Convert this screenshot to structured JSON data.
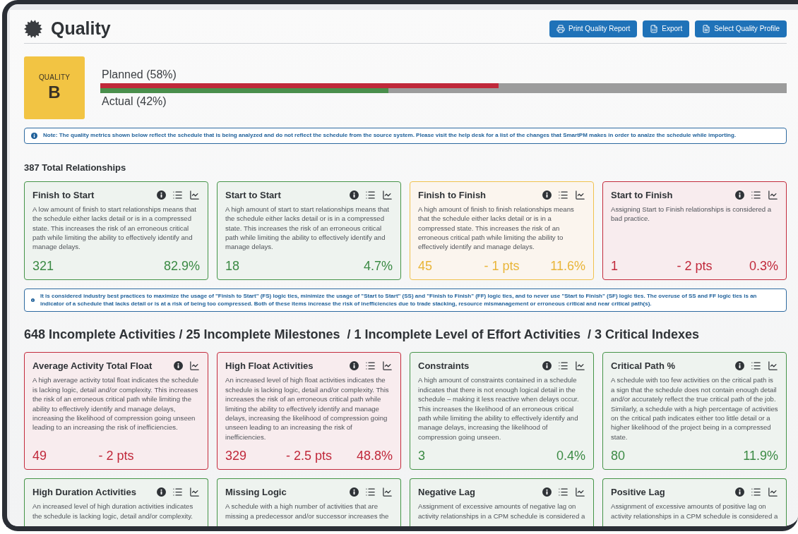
{
  "header": {
    "title": "Quality",
    "buttons": [
      {
        "label": "Print Quality Report",
        "kind": "print"
      },
      {
        "label": "Export",
        "kind": "export"
      },
      {
        "label": "Select Quality Profile",
        "kind": "profile"
      }
    ]
  },
  "grade": {
    "label": "QUALITY",
    "value": "B"
  },
  "progress": [
    {
      "label": "Planned (58%)",
      "kind": "planned",
      "level": 0.58
    },
    {
      "label": "Actual (42%)",
      "kind": "actual",
      "level": 0.42
    }
  ],
  "note": "Note: The quality metrics shown below reflect the schedule that is being analyzed and do not reflect the schedule from the source system. Please visit the help desk for a list of the changes that SmartPM makes in order to analze the schedule while importing.",
  "sections": [
    {
      "heading": "387 Total Relationships",
      "kind": "minor",
      "cards": [
        {
          "title": "Finish to Start",
          "kind": "good",
          "list_icon": true,
          "description": "A low amount of finish to start relationships means that the schedule either lacks detail or is in a compressed state. This increases the risk of an erroneous critical path while limiting the ability to effectively identify and manage delays.",
          "count": "321",
          "percent": "82.9%"
        },
        {
          "title": "Start to Start",
          "kind": "good",
          "list_icon": true,
          "description": "A high amount of start to start relationships means that the schedule either lacks detail or is in a compressed state. This increases the risk of an erroneous critical path while limiting the ability to effectively identify and manage delays.",
          "count": "18",
          "percent": "4.7%"
        },
        {
          "title": "Finish to Finish",
          "kind": "warning",
          "list_icon": true,
          "description": "A high amount of finish to finish relationships means that the schedule either lacks detail or is in a compressed state. This increases the risk of an erroneous critical path while limiting the ability to effectively identify and manage delays.",
          "count": "45",
          "points": "- 1 pts",
          "percent": "11.6%"
        },
        {
          "title": "Start to Finish",
          "kind": "bad",
          "list_icon": true,
          "description": "Assigning Start to Finish relationships is considered a bad practice.",
          "count": "1",
          "points": "- 2 pts",
          "percent": "0.3%"
        }
      ],
      "note": "It is considered industry best practices to maximize the usage of \"Finish to Start\" (FS) logic ties, minimize the usage of \"Start to Start\" (SS) and \"Finish to Finish\" (FF) logic ties, and to never use \"Start to Finish\" (SF) logic ties. The overuse of SS and FF logic ties is an indicator of a schedule that lacks detail or is at a risk of being too compressed. Both of these items increase the risk of inefficiencies due to trade stacking, resource mismanagement or erroneous critical and near critical path(s)."
    },
    {
      "heading": "648 Incomplete Activities / 25 Incomplete Milestones  / 1 Incomplete Level of Effort Activities  / 3 Critical Indexes",
      "kind": "major",
      "cards": [
        {
          "title": "Average Activity Total Float",
          "kind": "bad",
          "list_icon": false,
          "description": "A high average activity total float indicates the schedule is lacking logic, detail and/or complexity. This increases the risk of an erroneous critical path while limiting the ability to effectively identify and manage delays, increasing the likelihood of compression going unseen leading to an increasing the risk of inefficiencies.",
          "count": "49",
          "points": "- 2 pts"
        },
        {
          "title": "High Float Activities",
          "kind": "bad",
          "list_icon": true,
          "description": "An increased level of high float activities indicates the schedule is lacking logic, detail and/or complexity. This increases the risk of an erroneous critical path while limiting the ability to effectively identify and manage delays, increasing the likelihood of compression going unseen leading to an increasing the risk of inefficiencies.",
          "count": "329",
          "points": "- 2.5 pts",
          "percent": "48.8%"
        },
        {
          "title": "Constraints",
          "kind": "good",
          "list_icon": true,
          "description": "A high amount of constraints contained in a schedule indicates that there is not enough logical detail in the schedule – making it less reactive when delays occur. This increases the likelihood of an erroneous critical path while limiting the ability to effectively identify and manage delays, increasing the likelihood of compression going unseen.",
          "count": "3",
          "percent": "0.4%"
        },
        {
          "title": "Critical Path %",
          "kind": "good",
          "list_icon": true,
          "description": "A schedule with too few activities on the critical path is a sign that the schedule does not contain enough detail and/or accurately reflect the true critical path of the job. Similarly, a schedule with a high percentage of activities on the critical path indicates either too little detail or a higher likelihood of the project being in a compressed state.",
          "count": "80",
          "percent": "11.9%"
        },
        {
          "title": "High Duration Activities",
          "kind": "good",
          "list_icon": true,
          "description": "An increased level of high duration activities indicates the schedule is lacking logic, detail and/or complexity."
        },
        {
          "title": "Missing Logic",
          "kind": "good",
          "list_icon": true,
          "description": "A schedule with a high number of activities that are missing a predecessor and/or successor increases the"
        },
        {
          "title": "Negative Lag",
          "kind": "good",
          "list_icon": true,
          "description": "Assignment of excessive amounts of negative lag on activity relationships in a CPM schedule is considered a"
        },
        {
          "title": "Positive Lag",
          "kind": "good",
          "list_icon": true,
          "description": "Assignment of excessive amounts of positive lag on activity relationships in a CPM schedule is considered a"
        }
      ]
    }
  ]
}
